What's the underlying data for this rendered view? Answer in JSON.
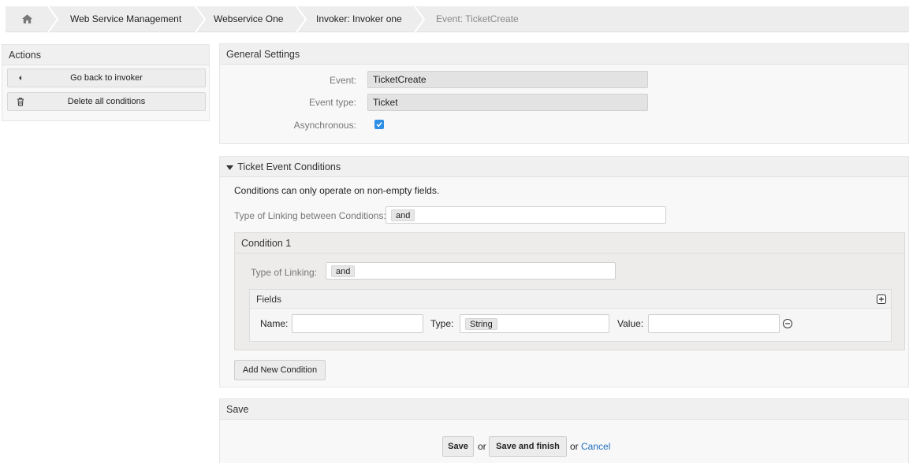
{
  "breadcrumb": {
    "items": [
      {
        "label": "Web Service Management"
      },
      {
        "label": "Webservice One"
      },
      {
        "label": "Invoker: Invoker one"
      },
      {
        "label": "Event: TicketCreate"
      }
    ]
  },
  "actions": {
    "title": "Actions",
    "go_back_label": "Go back to invoker",
    "delete_label": "Delete all conditions"
  },
  "general": {
    "title": "General Settings",
    "event_label": "Event:",
    "event_value": "TicketCreate",
    "event_type_label": "Event type:",
    "event_type_value": "Ticket",
    "async_label": "Asynchronous:",
    "async_checked": true
  },
  "conditions": {
    "title": "Ticket Event Conditions",
    "note": "Conditions can only operate on non-empty fields.",
    "linking_label": "Type of Linking between Conditions:",
    "linking_value": "and",
    "condition": {
      "title": "Condition 1",
      "linking_label": "Type of Linking:",
      "linking_value": "and",
      "fields_title": "Fields",
      "name_label": "Name:",
      "name_value": "",
      "type_label": "Type:",
      "type_value": "String",
      "value_label": "Value:",
      "value_value": ""
    },
    "add_condition_label": "Add New Condition"
  },
  "save": {
    "title": "Save",
    "save_label": "Save",
    "or1": "or",
    "save_finish_label": "Save and finish",
    "or2": "or",
    "cancel_label": "Cancel"
  },
  "colors": {
    "accent": "#2d8fe6",
    "link": "#1f6fbf"
  }
}
